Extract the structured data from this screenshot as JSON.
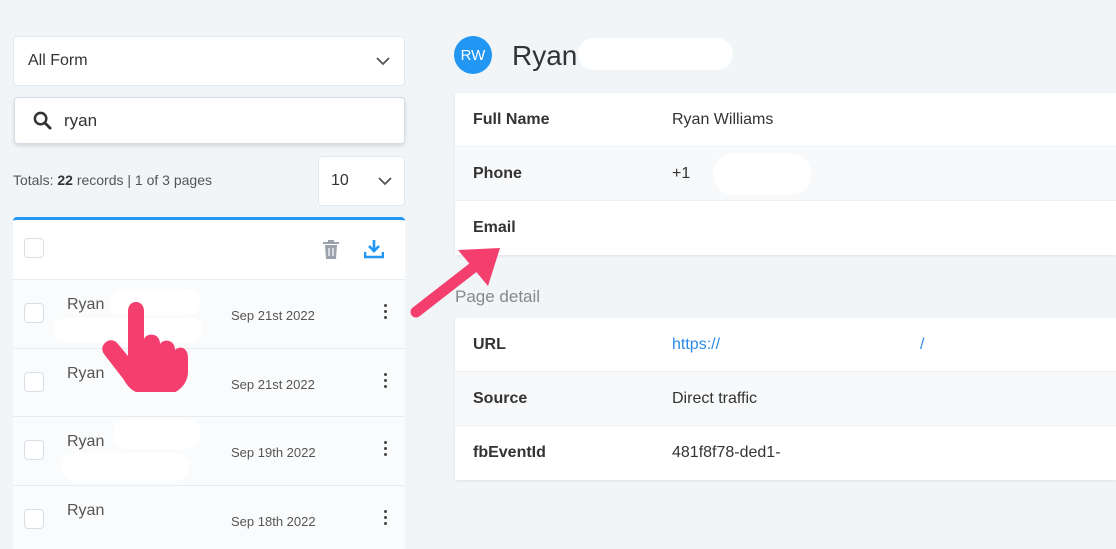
{
  "left": {
    "form_select": "All Form",
    "search_value": "ryan",
    "totals_prefix": "Totals: ",
    "totals_count": "22",
    "totals_suffix": " records | 1 of 3 pages",
    "per_page": "10",
    "rows": [
      {
        "name": "Ryan",
        "date": "Sep 21st 2022"
      },
      {
        "name": "Ryan",
        "date": "Sep 21st 2022"
      },
      {
        "name": "Ryan",
        "date": "Sep 19th 2022"
      },
      {
        "name": "Ryan",
        "date": "Sep 18th 2022"
      }
    ]
  },
  "contact": {
    "initials": "RW",
    "name": "Ryan"
  },
  "info": {
    "full_name_label": "Full Name",
    "full_name_value": "Ryan Williams",
    "phone_label": "Phone",
    "phone_value": "+1",
    "email_label": "Email",
    "email_value": ""
  },
  "page_detail": {
    "title": "Page detail",
    "url_label": "URL",
    "url_value": "https://",
    "url_tail": "/",
    "source_label": "Source",
    "source_value": "Direct traffic",
    "fb_label": "fbEventId",
    "fb_value": "481f8f78-ded1-"
  },
  "colors": {
    "accent": "#2196f3",
    "pointer": "#f43f6e"
  }
}
